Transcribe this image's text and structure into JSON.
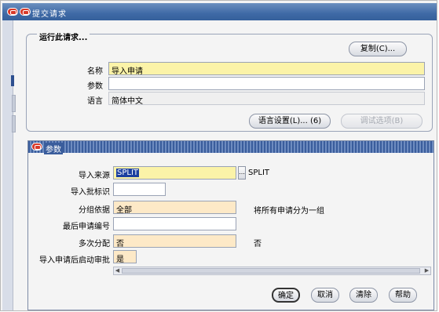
{
  "window": {
    "title": "提交请求"
  },
  "request_section": {
    "legend": "运行此请求...",
    "copy_button": "复制(C)...",
    "name_label": "名称",
    "name_value": "导入申请",
    "parameters_label": "参数",
    "parameters_value": "",
    "language_label": "语言",
    "language_value": "简体中文",
    "language_settings_button": "语言设置(L)... (6)",
    "debug_options_button": "调试选项(B)"
  },
  "parameters_dialog": {
    "title": "参数",
    "fields": [
      {
        "label": "导入来源",
        "value": "SPLIT",
        "description": "SPLIT"
      },
      {
        "label": "导入批标识",
        "value": "",
        "description": ""
      },
      {
        "label": "分组依据",
        "value": "全部",
        "description": "将所有申请分为一组"
      },
      {
        "label": "最后申请编号",
        "value": "",
        "description": ""
      },
      {
        "label": "多次分配",
        "value": "否",
        "description": "否"
      },
      {
        "label": "导入申请后启动审批",
        "value": "是",
        "description": ""
      }
    ],
    "buttons": {
      "ok": "确定",
      "cancel": "取消",
      "clear": "清除",
      "help": "帮助"
    }
  },
  "colors": {
    "title_bar": "#3f6aa6",
    "required_field": "#fbf3a8",
    "field_peach": "#fde9c7",
    "oracle_red": "#d83a2a"
  }
}
